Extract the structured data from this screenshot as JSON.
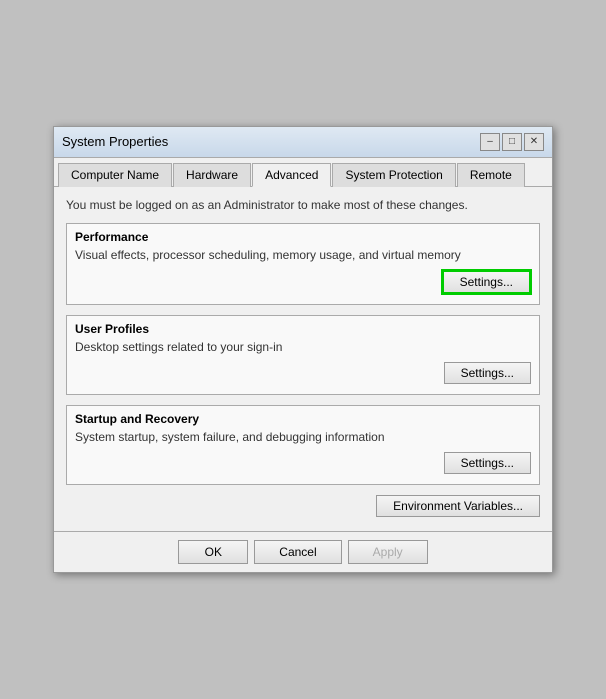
{
  "window": {
    "title": "System Properties"
  },
  "tabs": [
    {
      "label": "Computer Name",
      "active": false
    },
    {
      "label": "Hardware",
      "active": false
    },
    {
      "label": "Advanced",
      "active": true
    },
    {
      "label": "System Protection",
      "active": false
    },
    {
      "label": "Remote",
      "active": false
    }
  ],
  "admin_notice": "You must be logged on as an Administrator to make most of these changes.",
  "sections": [
    {
      "id": "performance",
      "title": "Performance",
      "desc": "Visual effects, processor scheduling, memory usage, and virtual memory",
      "btn_label": "Settings...",
      "highlighted": true
    },
    {
      "id": "user_profiles",
      "title": "User Profiles",
      "desc": "Desktop settings related to your sign-in",
      "btn_label": "Settings...",
      "highlighted": false
    },
    {
      "id": "startup_recovery",
      "title": "Startup and Recovery",
      "desc": "System startup, system failure, and debugging information",
      "btn_label": "Settings...",
      "highlighted": false
    }
  ],
  "env_btn_label": "Environment Variables...",
  "footer": {
    "ok": "OK",
    "cancel": "Cancel",
    "apply": "Apply"
  }
}
